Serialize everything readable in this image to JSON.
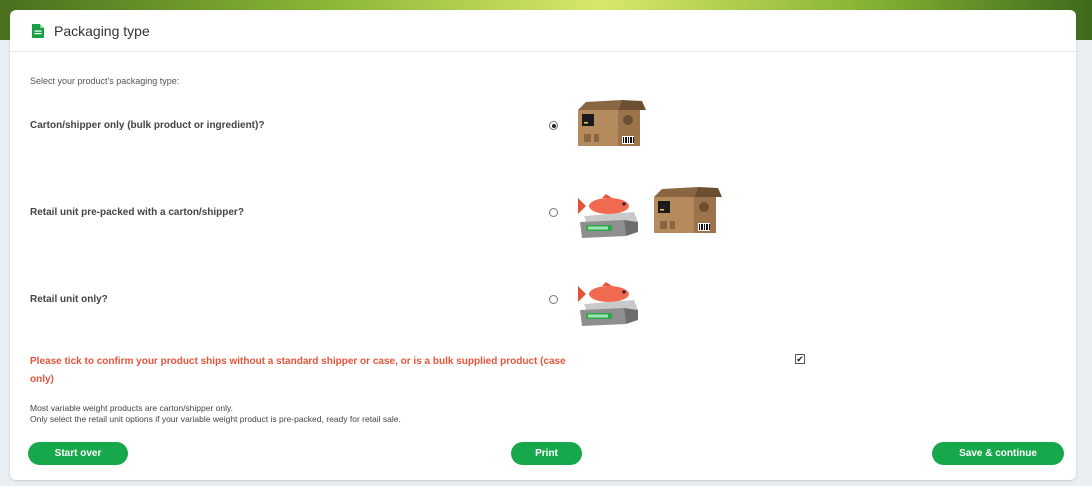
{
  "header": {
    "title": "Packaging type",
    "icon": "document-icon"
  },
  "intro_text": "Select your product's packaging type:",
  "options": [
    {
      "label": "Carton/shipper only (bulk product or ingredient)?",
      "selected": true,
      "images": [
        "carton-box"
      ]
    },
    {
      "label": "Retail unit pre-packed with a carton/shipper?",
      "selected": false,
      "images": [
        "retail-scale-fish",
        "carton-box"
      ]
    },
    {
      "label": "Retail unit only?",
      "selected": false,
      "images": [
        "retail-scale-fish"
      ]
    }
  ],
  "confirm": {
    "text": "Please tick to confirm your product ships without a standard shipper or case, or is a bulk supplied product (case only)",
    "checked": true,
    "checkmark": "✔"
  },
  "notes": [
    "Most variable weight products are carton/shipper only.",
    "Only select the retail unit options if your variable weight product is pre-packed, ready for retail sale."
  ],
  "buttons": {
    "start_over": "Start over",
    "print": "Print",
    "save_continue": "Save & continue"
  },
  "colors": {
    "accent": "#17a84b",
    "warning": "#e4553b",
    "carton": "#b58a5c",
    "fish": "#f06a4f"
  }
}
